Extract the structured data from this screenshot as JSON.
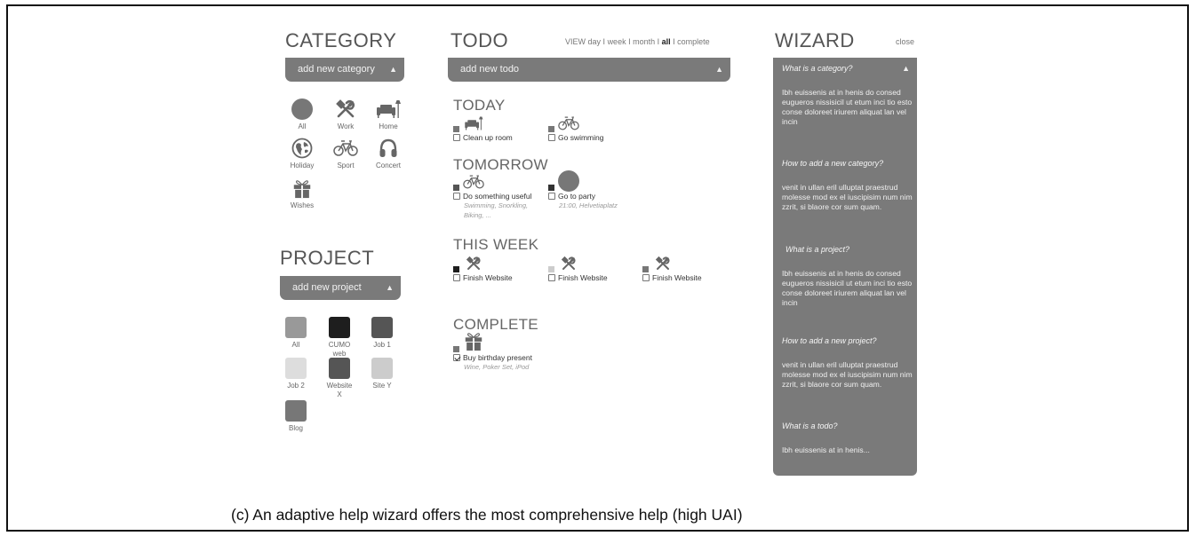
{
  "category": {
    "title": "CATEGORY",
    "dropdown_label": "add new category",
    "items": [
      {
        "label": "All",
        "icon": "circle-icon"
      },
      {
        "label": "Work",
        "icon": "tools-icon"
      },
      {
        "label": "Home",
        "icon": "sofa-icon"
      },
      {
        "label": "Holiday",
        "icon": "globe-icon"
      },
      {
        "label": "Sport",
        "icon": "bicycle-icon"
      },
      {
        "label": "Concert",
        "icon": "headphones-icon"
      },
      {
        "label": "Wishes",
        "icon": "gift-icon"
      }
    ]
  },
  "project": {
    "title": "PROJECT",
    "dropdown_label": "add new project",
    "items": [
      {
        "label": "All",
        "color": "#999999"
      },
      {
        "label": "CUMO web",
        "color": "#1e1e1e"
      },
      {
        "label": "Job 1",
        "color": "#555555"
      },
      {
        "label": "Job 2",
        "color": "#dddddd"
      },
      {
        "label": "Website X",
        "color": "#555555"
      },
      {
        "label": "Site Y",
        "color": "#cccccc"
      },
      {
        "label": "Blog",
        "color": "#777777"
      }
    ]
  },
  "todo": {
    "title": "TODO",
    "view_prefix": "VIEW",
    "views": [
      "day",
      "week",
      "month",
      "all",
      "complete"
    ],
    "separator": " I ",
    "dropdown_label": "add new todo",
    "sections": {
      "today": {
        "title": "TODAY",
        "items": [
          {
            "label": "Clean up room",
            "checked": false,
            "icon": "sofa-icon",
            "project_color": "#777777"
          },
          {
            "label": "Go swimming",
            "checked": false,
            "icon": "bicycle-icon",
            "project_color": "#777777"
          }
        ]
      },
      "tomorrow": {
        "title": "TOMORROW",
        "items": [
          {
            "label": "Do something useful",
            "checked": false,
            "icon": "bicycle-icon",
            "project_color": "#555555",
            "note": "Swimming, Snorkling, Biking, ..."
          },
          {
            "label": "Go to party",
            "checked": false,
            "icon": "circle-icon",
            "project_color": "#333333",
            "note": "21:00, Helvetiaplatz"
          }
        ]
      },
      "this_week": {
        "title": "THIS WEEK",
        "items": [
          {
            "label": "Finish Website",
            "checked": false,
            "icon": "tools-icon",
            "project_color": "#1e1e1e"
          },
          {
            "label": "Finish Website",
            "checked": false,
            "icon": "tools-icon",
            "project_color": "#cccccc"
          },
          {
            "label": "Finish Website",
            "checked": false,
            "icon": "tools-icon",
            "project_color": "#777777"
          }
        ]
      },
      "complete": {
        "title": "COMPLETE",
        "items": [
          {
            "label": "Buy birthday present",
            "checked": true,
            "icon": "gift-icon",
            "project_color": "#777777",
            "note": "Wine, Poker Set, iPod"
          }
        ]
      }
    }
  },
  "wizard": {
    "title": "WIZARD",
    "close_label": "close",
    "entries": [
      {
        "question": "What is a category?",
        "answer": "Ibh euissenis at in henis do consed eugueros nissisicil ut etum inci tio esto conse doloreet iriurem aliquat lan vel incin"
      },
      {
        "question": "How to add a new category?",
        "answer": "venit in ullan eril ulluptat praestrud molesse mod ex el iuscipisim num nim zzrit, si blaore cor sum quam."
      },
      {
        "question": "What is a project?",
        "answer": "Ibh euissenis at in henis do consed eugueros nissisicil ut etum inci tio esto conse doloreet iriurem aliquat lan vel incin"
      },
      {
        "question": "How to add a new project?",
        "answer": "venit in ullan eril ulluptat praestrud molesse mod ex el iuscipisim num nim zzrit, si blaore cor sum quam."
      },
      {
        "question": "What is a todo?",
        "answer": "Ibh euissenis at in henis..."
      }
    ]
  },
  "caption": "(c)  An adaptive help wizard offers the most comprehensive help (high UAI)"
}
